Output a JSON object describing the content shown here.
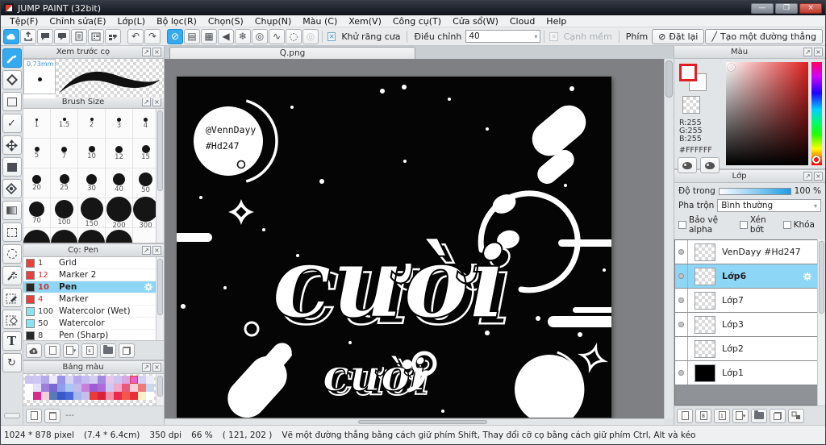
{
  "window": {
    "title": "JUMP PAINT (32bit)"
  },
  "menu": {
    "items": [
      "Tệp(F)",
      "Chỉnh sửa(E)",
      "Lớp(L)",
      "Bộ lọc(R)",
      "Chọn(S)",
      "Chụp(N)",
      "Màu (C)",
      "Xem(V)",
      "Công cụ(T)",
      "Cửa sổ(W)",
      "Cloud",
      "Help"
    ]
  },
  "toolbar": {
    "antialias_label": "Khử răng cưa",
    "adjust_label": "Điều chỉnh",
    "adjust_value": "40",
    "soft_edge_label": "Cạnh mềm",
    "key_label": "Phím",
    "reset_label": "Đặt lại",
    "line_label": "Tạo một đường thẳng"
  },
  "panels": {
    "brush_preview": {
      "title": "Xem trước cọ",
      "size_chip": "0.73mm"
    },
    "brush_size": {
      "title": "Brush Size",
      "rows": [
        [
          "1",
          "1.5",
          "2",
          "3",
          "4"
        ],
        [
          "5",
          "7",
          "10",
          "12",
          "15"
        ],
        [
          "20",
          "25",
          "30",
          "40",
          "50"
        ],
        [
          "70",
          "100",
          "150",
          "200",
          "300"
        ]
      ]
    },
    "brushes": {
      "title": "Cọ: Pen",
      "items": [
        {
          "swatch": "#e8413c",
          "size": "1",
          "size_color": "#333333",
          "name": "Grid"
        },
        {
          "swatch": "#e8413c",
          "size": "12",
          "size_color": "#d03030",
          "name": "Marker 2"
        },
        {
          "swatch": "#26282a",
          "size": "10",
          "size_color": "#d03030",
          "name": "Pen",
          "selected": true
        },
        {
          "swatch": "#e8413c",
          "size": "4",
          "size_color": "#d03030",
          "name": "Marker"
        },
        {
          "swatch": "#8ae2f2",
          "size": "100",
          "size_color": "#333333",
          "name": "Watercolor (Wet)"
        },
        {
          "swatch": "#8ae2f2",
          "size": "50",
          "size_color": "#333333",
          "name": "Watercolor"
        },
        {
          "swatch": "#26282a",
          "size": "8",
          "size_color": "#333333",
          "name": "Pen (Sharp)"
        }
      ]
    },
    "palette": {
      "title": "Bảng màu",
      "footer": "---",
      "selected_index": 13,
      "colors": [
        "#c9c3ef",
        "#cdc7f1",
        "#b4a9ea",
        "#eceaf9",
        "#9a92e8",
        "#d6d2f4",
        "#b7a7ec",
        "#c5bcef",
        "#d4cdf2",
        "#a188e2",
        "#e5c6ec",
        "#ccc5f0",
        "#d9a8e4",
        "#ea5ec9",
        "#d6d0f2",
        "#eeeefb",
        "#ffffff",
        "#e5e1f7",
        "#9b7fdb",
        "#7a69d2",
        "#8f9eea",
        "#a9c7f1",
        "#c3bbee",
        "#c77fd9",
        "#9a5ed1",
        "#b069da",
        "#cfc9f1",
        "#f1a8c9",
        "#ea587b",
        "#f3d1d9",
        "#ef7a7b",
        "#c9d8f1",
        "#ffffff",
        "#d92b8b",
        "#f3d0da",
        "#5a79b9",
        "#3a59c9",
        "#4a69d9",
        "#a8b7eb",
        "#c4bfee",
        "#e93a3a",
        "#d9203a",
        "#f18fa8",
        "#e92a4a",
        "#f3564a",
        "#e9303a",
        "#f9f1c9",
        "#ffffff"
      ]
    }
  },
  "canvas": {
    "tab": "Q.png",
    "credit1": "@VennDayy",
    "credit2": "#Hd247",
    "word_main": "cười",
    "word_small": "cười",
    "dots": [
      [
        255,
        18,
        3
      ],
      [
        338,
        28,
        2
      ],
      [
        490,
        15,
        3
      ],
      [
        283,
        105,
        2
      ],
      [
        180,
        130,
        3
      ],
      [
        30,
        150,
        2
      ],
      [
        108,
        190,
        2
      ],
      [
        150,
        222,
        2
      ],
      [
        255,
        250,
        3
      ],
      [
        385,
        65,
        2
      ],
      [
        8,
        285,
        3
      ],
      [
        60,
        262,
        2
      ],
      [
        140,
        345,
        3
      ],
      [
        215,
        330,
        2
      ],
      [
        385,
        318,
        3
      ],
      [
        330,
        415,
        2
      ],
      [
        448,
        300,
        3
      ],
      [
        143,
        38,
        2
      ],
      [
        482,
        135,
        2
      ],
      [
        282,
        13,
        3
      ],
      [
        530,
        240,
        2
      ],
      [
        500,
        320,
        3
      ]
    ]
  },
  "color_panel": {
    "title": "Màu",
    "r_label": "R:255",
    "g_label": "G:255",
    "b_label": "B:255",
    "hex": "#FFFFFF"
  },
  "layers_panel": {
    "title": "Lớp",
    "opacity_label": "Độ trong",
    "opacity_value": "100 %",
    "blend_label": "Pha trộn",
    "blend_value": "Bình thường",
    "checks": [
      "Bảo vệ alpha",
      "Xén bớt",
      "Khóa"
    ],
    "layers": [
      {
        "name": "VenDayy #Hd247",
        "thumb": "checker",
        "visible": true
      },
      {
        "name": "Lớp6",
        "thumb": "checker",
        "visible": true,
        "selected": true
      },
      {
        "name": "Lớp7",
        "thumb": "checker",
        "visible": true
      },
      {
        "name": "Lớp3",
        "thumb": "checker",
        "visible": true
      },
      {
        "name": "Lớp2",
        "thumb": "checker",
        "visible": false
      },
      {
        "name": "Lớp1",
        "thumb": "black",
        "visible": true
      }
    ]
  },
  "status": {
    "size": "1024 * 878 pixel",
    "dims": "(7.4 * 6.4cm)",
    "dpi": "350 dpi",
    "zoom": "66 %",
    "coords": "( 121, 202 )",
    "hint": "Vẽ một đường thẳng bằng cách giữ phím Shift, Thay đổi cỡ cọ bằng cách giữ phím Ctrl, Alt và kéo"
  }
}
